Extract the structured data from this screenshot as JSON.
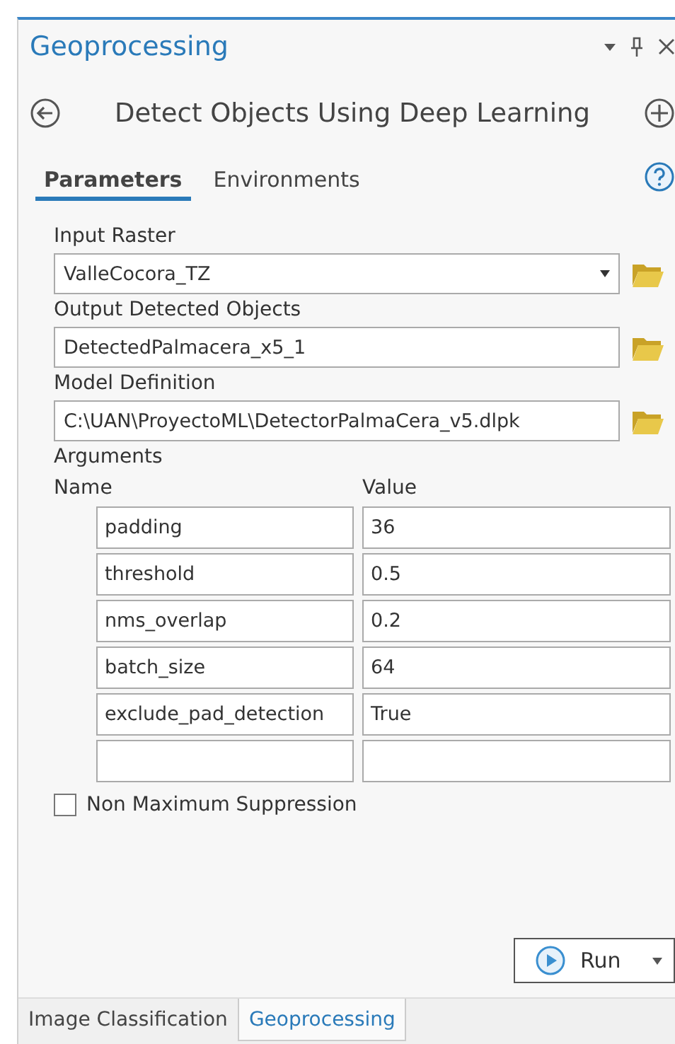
{
  "pane": {
    "title": "Geoprocessing"
  },
  "tool": {
    "title": "Detect Objects Using Deep Learning"
  },
  "tabs": [
    {
      "label": "Parameters",
      "selected": true
    },
    {
      "label": "Environments",
      "selected": false
    }
  ],
  "parameters": [
    {
      "label": "Input Raster",
      "value": "ValleCocora_TZ",
      "kind": "dropdown"
    },
    {
      "label": "Output Detected Objects",
      "value": "DetectedPalmacera_x5_1",
      "kind": "text"
    },
    {
      "label": "Model Definition",
      "value": "C:\\UAN\\ProyectoML\\DetectorPalmaCera_v5.dlpk",
      "kind": "text"
    }
  ],
  "arguments": {
    "label": "Arguments",
    "columns": [
      "Name",
      "Value"
    ],
    "rows": [
      {
        "name": "padding",
        "value": "36"
      },
      {
        "name": "threshold",
        "value": "0.5"
      },
      {
        "name": "nms_overlap",
        "value": "0.2"
      },
      {
        "name": "batch_size",
        "value": "64"
      },
      {
        "name": "exclude_pad_detection",
        "value": "True"
      },
      {}
    ]
  },
  "non_maximum_suppression": {
    "label": "Non Maximum Suppression",
    "checked": false
  },
  "run_button": {
    "label": "Run"
  },
  "bottom_tabs": [
    {
      "label": "Image Classification",
      "selected": false
    },
    {
      "label": "Geoprocessing",
      "selected": true
    }
  ]
}
